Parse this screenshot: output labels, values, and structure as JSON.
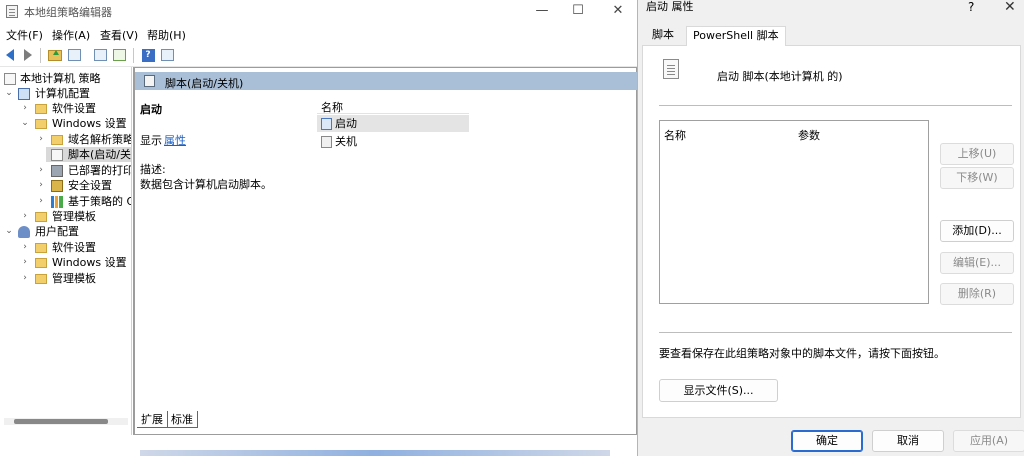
{
  "main_window": {
    "title": "本地组策略编辑器",
    "controls": {
      "minimize": "—",
      "maximize": "☐",
      "close": "✕"
    },
    "menu": [
      "文件(F)",
      "操作(A)",
      "查看(V)",
      "帮助(H)"
    ],
    "toolbar_icons": [
      "back-arrow-icon",
      "forward-arrow-icon",
      "folder-up-icon",
      "show-hide-tree-icon",
      "properties-icon",
      "export-list-icon",
      "help-icon",
      "view-icon"
    ],
    "tree": {
      "root": "本地计算机 策略",
      "computer_config": "计算机配置",
      "software_settings": "软件设置",
      "windows_settings": "Windows 设置",
      "name_resolution": "域名解析策略",
      "scripts": "脚本(启动/关",
      "printers": "已部署的打印",
      "security": "安全设置",
      "qos": "基于策略的 Q",
      "admin_templates": "管理模板",
      "user_config": "用户配置",
      "user_software": "软件设置",
      "user_windows": "Windows 设置",
      "user_admin": "管理模板"
    },
    "content": {
      "header": "脚本(启动/关机)",
      "title": "启动",
      "show_label": "显示",
      "properties_link": "属性",
      "desc_label": "描述:",
      "desc_text": "数据包含计算机启动脚本。",
      "list_header": "名称",
      "items": [
        "启动",
        "关机"
      ]
    },
    "bottom_tabs": [
      "扩展",
      "标准"
    ]
  },
  "dialog": {
    "title": "启动 属性",
    "help": "?",
    "close": "✕",
    "tabs": [
      "脚本",
      "PowerShell 脚本"
    ],
    "heading": "启动 脚本(本地计算机 的)",
    "columns": [
      "名称",
      "参数"
    ],
    "buttons": {
      "up": "上移(U)",
      "down": "下移(W)",
      "add": "添加(D)...",
      "edit": "编辑(E)...",
      "remove": "删除(R)"
    },
    "hint": "要查看保存在此组策略对象中的脚本文件，请按下面按钮。",
    "show_files": "显示文件(S)...",
    "ok": "确定",
    "cancel": "取消",
    "apply": "应用(A)"
  }
}
